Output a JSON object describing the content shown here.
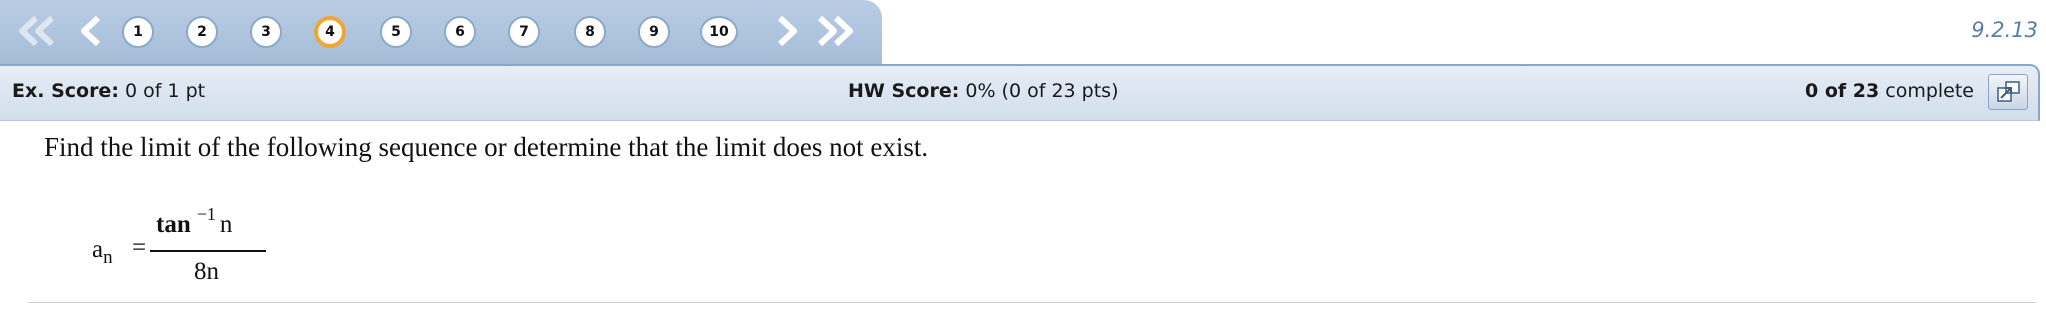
{
  "nav": {
    "questions": [
      "1",
      "2",
      "3",
      "4",
      "5",
      "6",
      "7",
      "8",
      "9",
      "10"
    ],
    "current_question": "4",
    "version": "9.2.13"
  },
  "score_bar": {
    "ex_label": "Ex. Score:",
    "ex_value": "0 of 1 pt",
    "hw_label": "HW Score:",
    "hw_value": "0% (0 of 23 pts)",
    "complete_count": "0 of 23",
    "complete_label": "complete"
  },
  "question": {
    "prompt": "Find the limit of the following sequence or determine that the limit does not exist.",
    "formula": {
      "lhs": "a",
      "lhs_sub": "n",
      "equals": "=",
      "num_func": "tan",
      "num_sup": "−1",
      "num_arg": "n",
      "denominator": "8n"
    }
  },
  "colors": {
    "nav_bg": "#a6bcd8",
    "current_ring": "#f2a531",
    "version_text": "#5c7ea8",
    "score_bar_bg": "#dbe4ef"
  },
  "icons": {
    "first": "double-chevron-left-icon",
    "prev": "chevron-left-icon",
    "next": "chevron-right-icon",
    "last": "double-chevron-right-icon",
    "popout": "popout-window-icon"
  }
}
